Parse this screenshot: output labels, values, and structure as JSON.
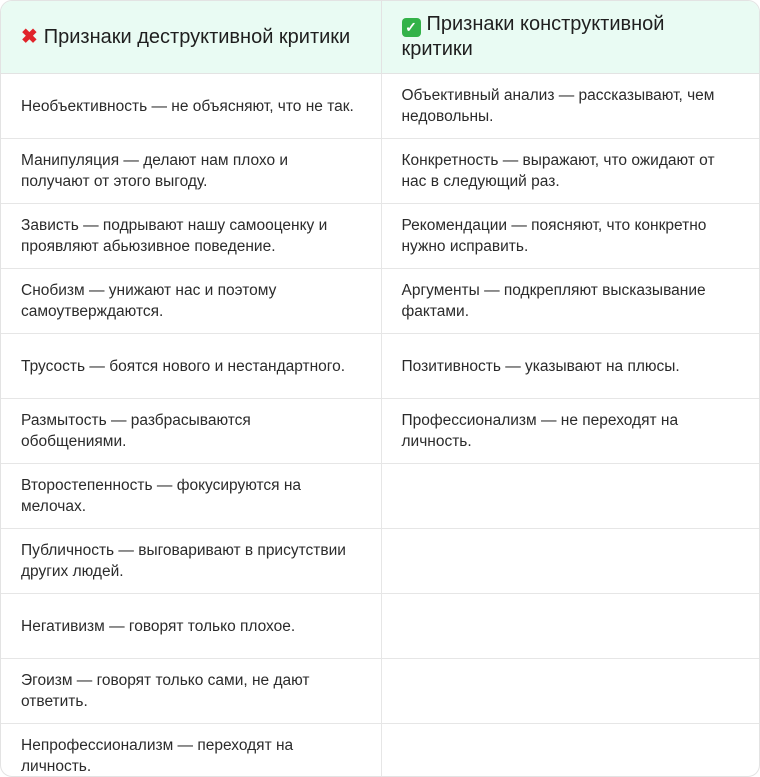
{
  "header": {
    "left": {
      "icon": "red-cross-icon",
      "title": "Признаки деструктивной критики"
    },
    "right": {
      "icon": "green-check-icon",
      "title": "Признаки конструктивной критики"
    }
  },
  "rows": [
    {
      "left": "Необъективность — не объясняют, что не так.",
      "right": "Объективный анализ — рассказывают, чем недовольны."
    },
    {
      "left": "Манипуляция — делают нам плохо и получают от этого выгоду.",
      "right": "Конкретность — выражают, что ожидают от нас в следующий раз."
    },
    {
      "left": "Зависть — подрывают нашу самооценку и проявляют абьюзивное поведение.",
      "right": "Рекомендации — поясняют, что конкретно нужно исправить."
    },
    {
      "left": "Снобизм — унижают нас и поэтому самоутверждаются.",
      "right": "Аргументы — подкрепляют высказывание фактами."
    },
    {
      "left": "Трусость — боятся нового и нестандартного.",
      "right": "Позитивность — указывают на плюсы."
    },
    {
      "left": "Размытость — разбрасываются обобщениями.",
      "right": "Профессионализм — не переходят на личность."
    },
    {
      "left": "Второстепенность — фокусируются на мелочах.",
      "right": ""
    },
    {
      "left": "Публичность — выговаривают в присутствии других людей.",
      "right": ""
    },
    {
      "left": "Негативизм — говорят только плохое.",
      "right": ""
    },
    {
      "left": "Эгоизм — говорят только сами, не дают ответить.",
      "right": ""
    },
    {
      "left": "Непрофессионализм — переходят на личность.",
      "right": ""
    }
  ],
  "colors": {
    "header_bg": "#e9fbf3",
    "cross": "#e0242a",
    "check": "#33b249",
    "border": "#e3e3e3"
  }
}
